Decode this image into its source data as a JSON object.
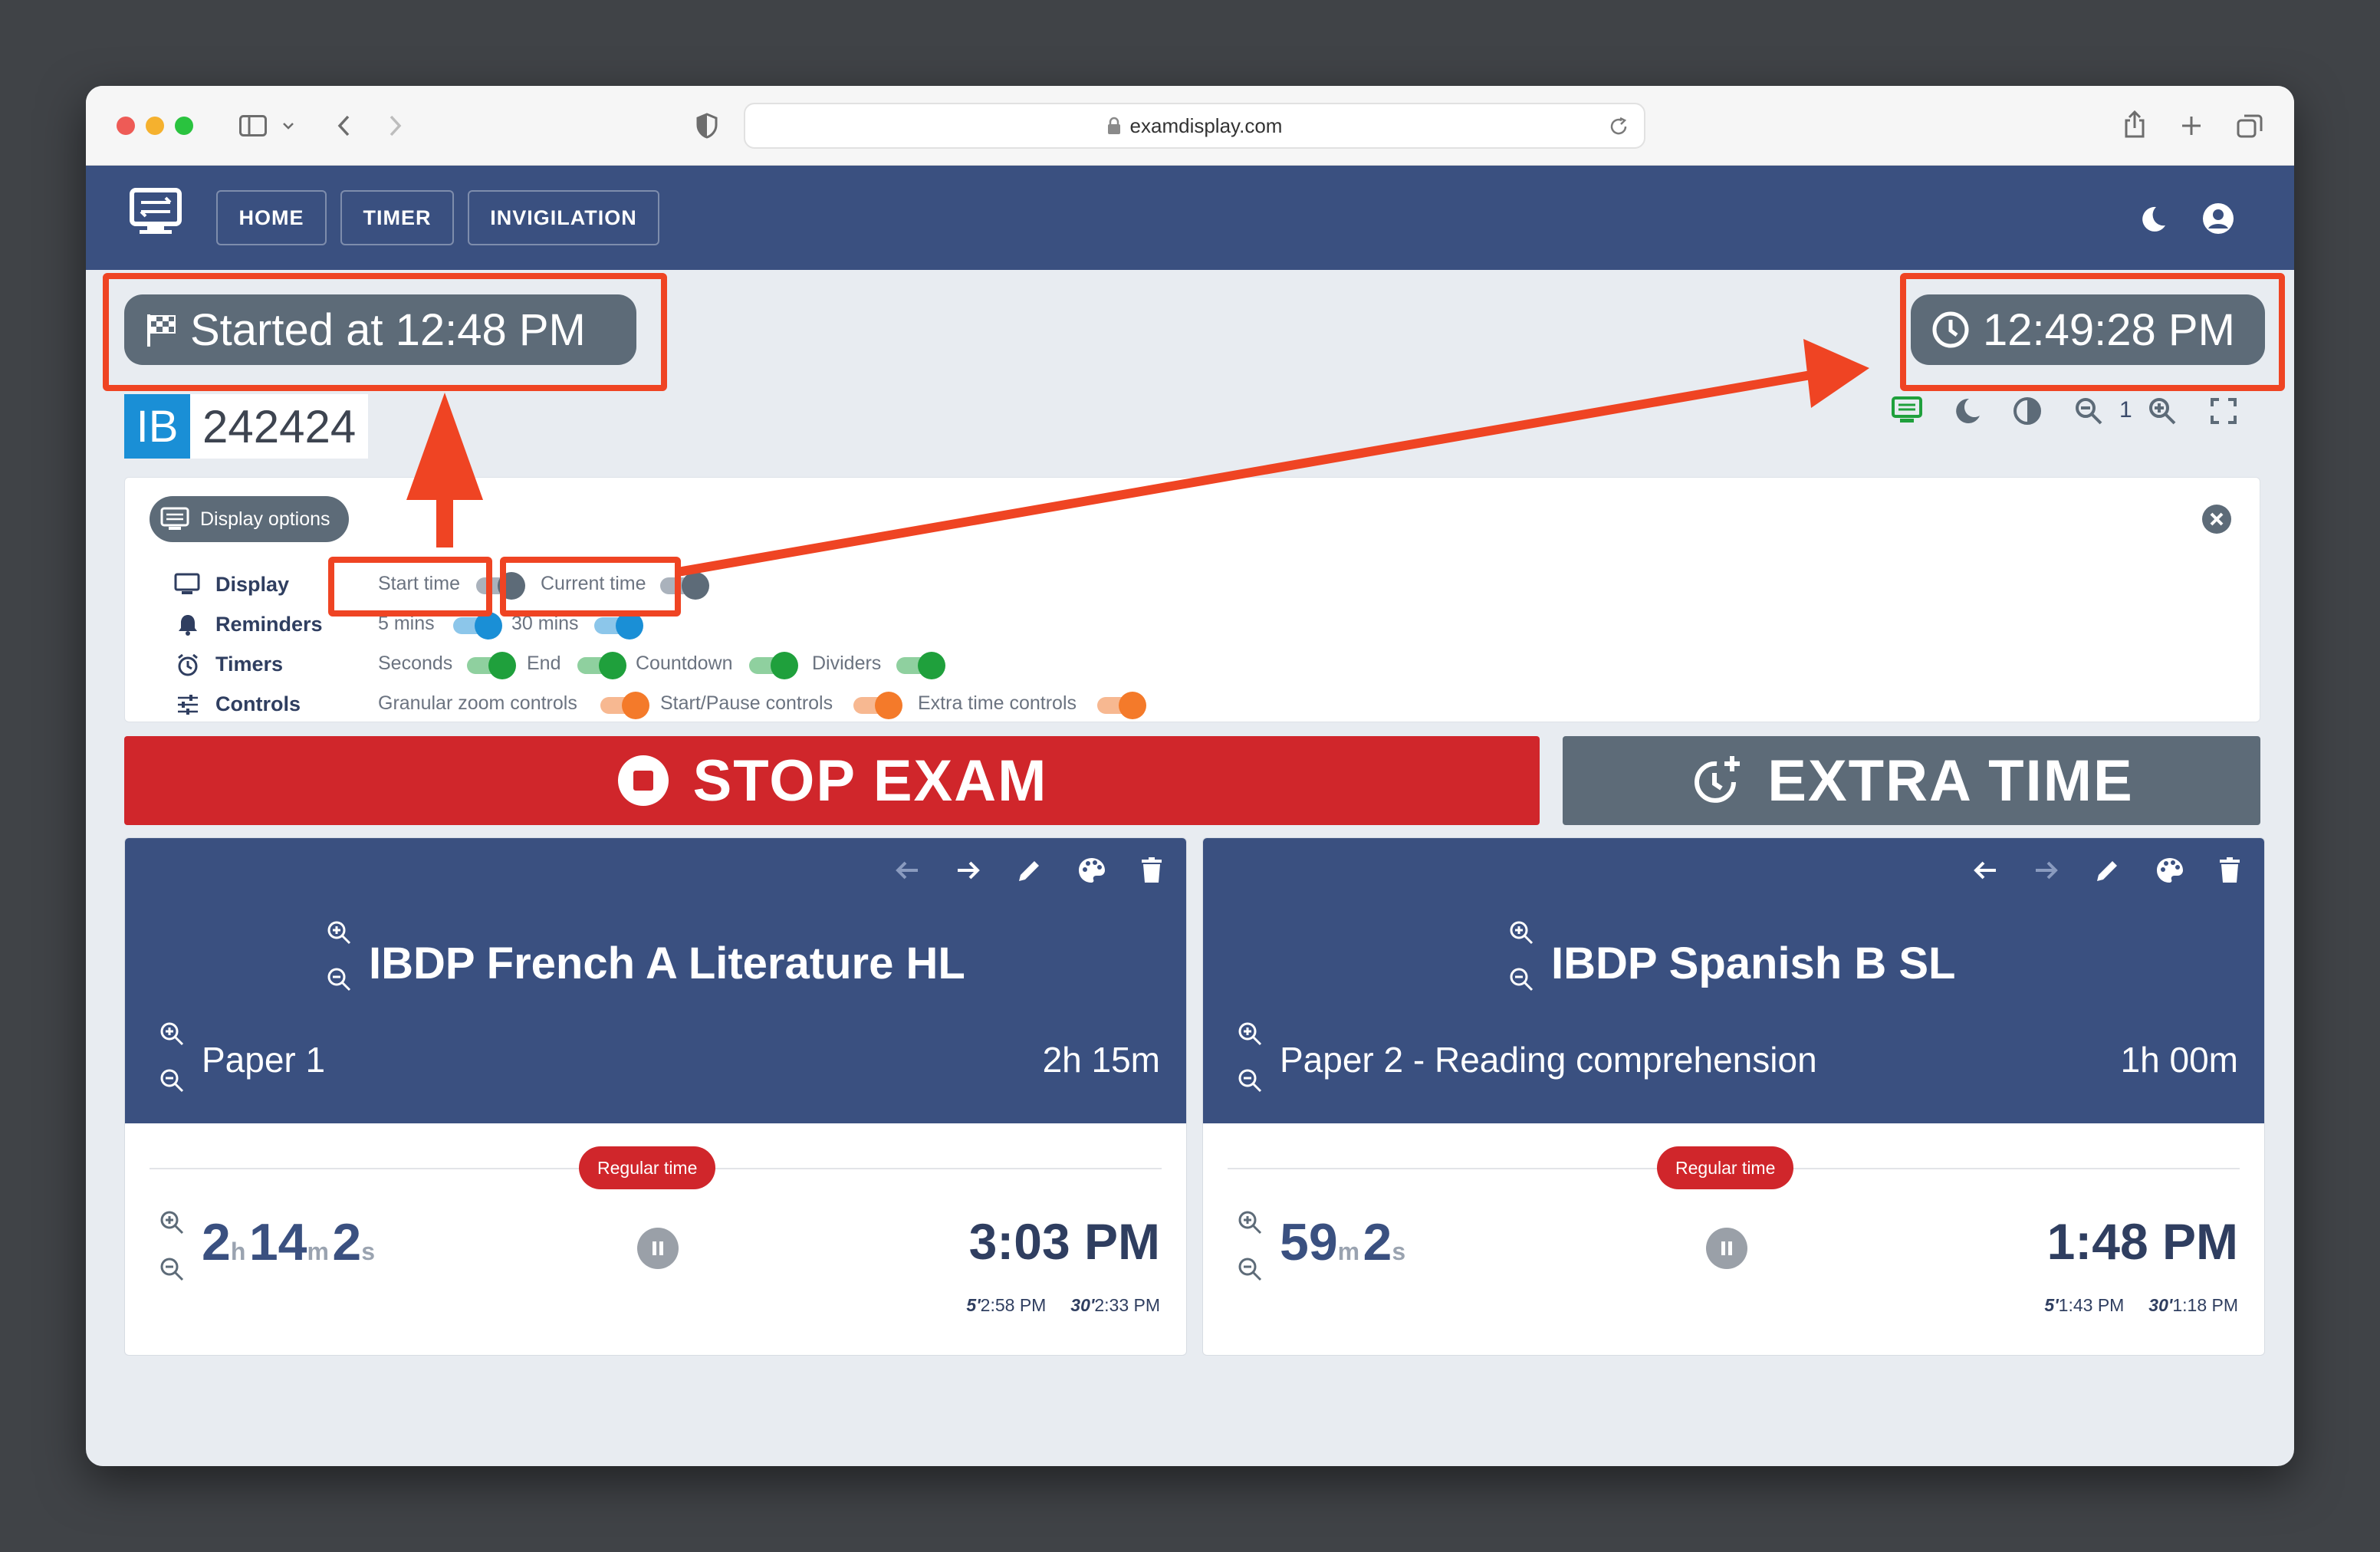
{
  "browser": {
    "url": "examdisplay.com"
  },
  "nav": {
    "items": [
      "HOME",
      "TIMER",
      "INVIGILATION"
    ]
  },
  "status": {
    "started": "Started at 12:48 PM",
    "clock": "12:49:28 PM"
  },
  "exam_code": {
    "board": "IB",
    "number": "242424"
  },
  "toolbar": {
    "zoom_level": "1"
  },
  "display_options": {
    "title": "Display options",
    "rows": {
      "display": {
        "label": "Display",
        "items": [
          "Start time",
          "Current time"
        ]
      },
      "reminders": {
        "label": "Reminders",
        "items": [
          "5 mins",
          "30 mins"
        ]
      },
      "timers": {
        "label": "Timers",
        "items": [
          "Seconds",
          "End",
          "Countdown",
          "Dividers"
        ]
      },
      "controls": {
        "label": "Controls",
        "items": [
          "Granular zoom controls",
          "Start/Pause controls",
          "Extra time controls"
        ]
      }
    }
  },
  "actions": {
    "stop": "STOP EXAM",
    "extra": "EXTRA TIME"
  },
  "exams": [
    {
      "title": "IBDP French A Literature HL",
      "paper": "Paper 1",
      "duration": "2h 15m",
      "badge": "Regular time",
      "remaining": {
        "h": "2",
        "m": "14",
        "s": "2",
        "hu": "h",
        "mu": "m",
        "su": "s"
      },
      "end": "3:03 PM",
      "reminders": {
        "r5_label": "5'",
        "r5": "2:58 PM",
        "r30_label": "30'",
        "r30": "2:33 PM"
      }
    },
    {
      "title": "IBDP Spanish B SL",
      "paper": "Paper 2 - Reading comprehension",
      "duration": "1h 00m",
      "badge": "Regular time",
      "remaining": {
        "m": "59",
        "s": "2",
        "mu": "m",
        "su": "s"
      },
      "end": "1:48 PM",
      "reminders": {
        "r5_label": "5'",
        "r5": "1:43 PM",
        "r30_label": "30'",
        "r30": "1:18 PM"
      }
    }
  ],
  "colors": {
    "nav_bg": "#3a5080",
    "stop": "#d0262b",
    "extra": "#5d6b78",
    "toggle_grey": "#5d6b78",
    "toggle_blue": "#1a8fd6",
    "toggle_green": "#1fa03c",
    "toggle_orange": "#f47a2a",
    "annotation": "#ef4423"
  }
}
